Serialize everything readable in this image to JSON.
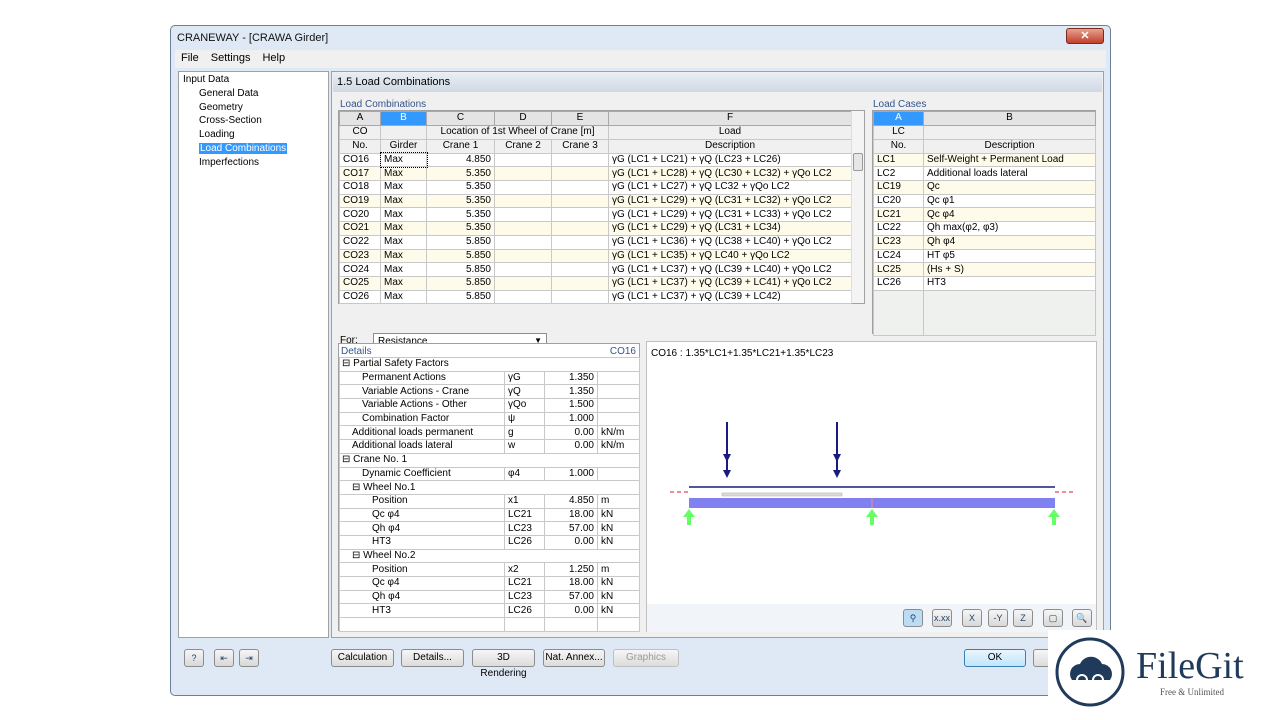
{
  "window": {
    "title": "CRANEWAY - [CRAWA Girder]",
    "close": "✕"
  },
  "menu": [
    "File",
    "Settings",
    "Help"
  ],
  "tree": {
    "root": "Input Data",
    "items": [
      "General Data",
      "Geometry",
      "Cross-Section",
      "Loading",
      "Load Combinations",
      "Imperfections"
    ],
    "selected": "Load Combinations"
  },
  "header": "1.5 Load Combinations",
  "load_combinations": {
    "title": "Load Combinations",
    "col_letters": [
      "A",
      "B",
      "C",
      "D",
      "E",
      "F"
    ],
    "head1": [
      "CO",
      "",
      "Location of 1st Wheel of Crane [m]",
      "Load"
    ],
    "head2": [
      "No.",
      "Girder",
      "Crane 1",
      "Crane 2",
      "Crane 3",
      "Description"
    ],
    "rows": [
      [
        "CO16",
        "Max",
        "4.850",
        "",
        "",
        "γG (LC1 + LC21) + γQ (LC23 + LC26)"
      ],
      [
        "CO17",
        "Max",
        "5.350",
        "",
        "",
        "γG (LC1 + LC28) + γQ (LC30 + LC32) + γQo LC2"
      ],
      [
        "CO18",
        "Max",
        "5.350",
        "",
        "",
        "γG (LC1 + LC27) + γQ LC32 + γQo LC2"
      ],
      [
        "CO19",
        "Max",
        "5.350",
        "",
        "",
        "γG (LC1 + LC29) + γQ (LC31 + LC32) + γQo LC2"
      ],
      [
        "CO20",
        "Max",
        "5.350",
        "",
        "",
        "γG (LC1 + LC29) + γQ (LC31 + LC33) + γQo LC2"
      ],
      [
        "CO21",
        "Max",
        "5.350",
        "",
        "",
        "γG (LC1 + LC29) + γQ (LC31 + LC34)"
      ],
      [
        "CO22",
        "Max",
        "5.850",
        "",
        "",
        "γG (LC1 + LC36) + γQ (LC38 + LC40) + γQo LC2"
      ],
      [
        "CO23",
        "Max",
        "5.850",
        "",
        "",
        "γG (LC1 + LC35) + γQ LC40 + γQo LC2"
      ],
      [
        "CO24",
        "Max",
        "5.850",
        "",
        "",
        "γG (LC1 + LC37) + γQ (LC39 + LC40) + γQo LC2"
      ],
      [
        "CO25",
        "Max",
        "5.850",
        "",
        "",
        "γG (LC1 + LC37) + γQ (LC39 + LC41) + γQo LC2"
      ],
      [
        "CO26",
        "Max",
        "5.850",
        "",
        "",
        "γG (LC1 + LC37) + γQ (LC39 + LC42)"
      ]
    ]
  },
  "for": {
    "label": "For:",
    "value": "Resistance"
  },
  "load_cases": {
    "title": "Load Cases",
    "col_letters": [
      "A",
      "B"
    ],
    "head1": [
      "LC",
      ""
    ],
    "head2": [
      "No.",
      "Description"
    ],
    "rows": [
      [
        "LC1",
        "Self-Weight + Permanent Load"
      ],
      [
        "LC2",
        "Additional loads lateral"
      ],
      [
        "LC19",
        "Qc"
      ],
      [
        "LC20",
        "Qc φ1"
      ],
      [
        "LC21",
        "Qc φ4"
      ],
      [
        "LC22",
        "Qh max(φ2, φ3)"
      ],
      [
        "LC23",
        "Qh φ4"
      ],
      [
        "LC24",
        "HT φ5"
      ],
      [
        "LC25",
        "(Hs + S)"
      ],
      [
        "LC26",
        "HT3"
      ]
    ]
  },
  "details": {
    "title": "Details",
    "co": "CO16",
    "rows": [
      {
        "l": "⊟ Partial Safety Factors",
        "i": 0,
        "group": true
      },
      {
        "l": "Permanent Actions",
        "i": 2,
        "s": "γG",
        "v": "1.350",
        "u": ""
      },
      {
        "l": "Variable Actions - Crane",
        "i": 2,
        "s": "γQ",
        "v": "1.350",
        "u": ""
      },
      {
        "l": "Variable Actions - Other",
        "i": 2,
        "s": "γQo",
        "v": "1.500",
        "u": ""
      },
      {
        "l": "Combination Factor",
        "i": 2,
        "s": "ψ",
        "v": "1.000",
        "u": ""
      },
      {
        "l": "Additional loads permanent",
        "i": 1,
        "s": "g",
        "v": "0.00",
        "u": "kN/m"
      },
      {
        "l": "Additional loads lateral",
        "i": 1,
        "s": "w",
        "v": "0.00",
        "u": "kN/m"
      },
      {
        "l": "⊟ Crane No. 1",
        "i": 0,
        "group": true
      },
      {
        "l": "Dynamic Coefficient",
        "i": 2,
        "s": "φ4",
        "v": "1.000",
        "u": ""
      },
      {
        "l": "⊟ Wheel No.1",
        "i": 1,
        "group": true
      },
      {
        "l": "Position",
        "i": 3,
        "s": "x1",
        "v": "4.850",
        "u": "m"
      },
      {
        "l": "Qc φ4",
        "i": 3,
        "s": "LC21",
        "v": "18.00",
        "u": "kN"
      },
      {
        "l": "Qh φ4",
        "i": 3,
        "s": "LC23",
        "v": "57.00",
        "u": "kN"
      },
      {
        "l": "HT3",
        "i": 3,
        "s": "LC26",
        "v": "0.00",
        "u": "kN"
      },
      {
        "l": "⊟ Wheel No.2",
        "i": 1,
        "group": true
      },
      {
        "l": "Position",
        "i": 3,
        "s": "x2",
        "v": "1.250",
        "u": "m"
      },
      {
        "l": "Qc φ4",
        "i": 3,
        "s": "LC21",
        "v": "18.00",
        "u": "kN"
      },
      {
        "l": "Qh φ4",
        "i": 3,
        "s": "LC23",
        "v": "57.00",
        "u": "kN"
      },
      {
        "l": "HT3",
        "i": 3,
        "s": "LC26",
        "v": "0.00",
        "u": "kN"
      }
    ]
  },
  "graphic": {
    "caption": "CO16 : 1.35*LC1+1.35*LC21+1.35*LC23",
    "colors": {
      "beam": "#8080f0",
      "load": "#1a1a80",
      "support": "#66ff66"
    },
    "tools": [
      "show-model-icon",
      "values-icon",
      "view-x-icon",
      "view-y-icon",
      "view-z-icon",
      "iso-view-icon",
      "zoom-reset-icon"
    ],
    "tool_glyphs": [
      "⚲",
      "x.xx",
      "X",
      "-Y",
      "Z",
      "▢",
      "🔍"
    ]
  },
  "buttons": {
    "calculation": "Calculation",
    "details": "Details...",
    "rendering": "3D Rendering",
    "annex": "Nat. Annex...",
    "graphics": "Graphics",
    "ok": "OK"
  },
  "watermark": {
    "name": "FileGit",
    "tagline": "Free & Unlimited"
  }
}
